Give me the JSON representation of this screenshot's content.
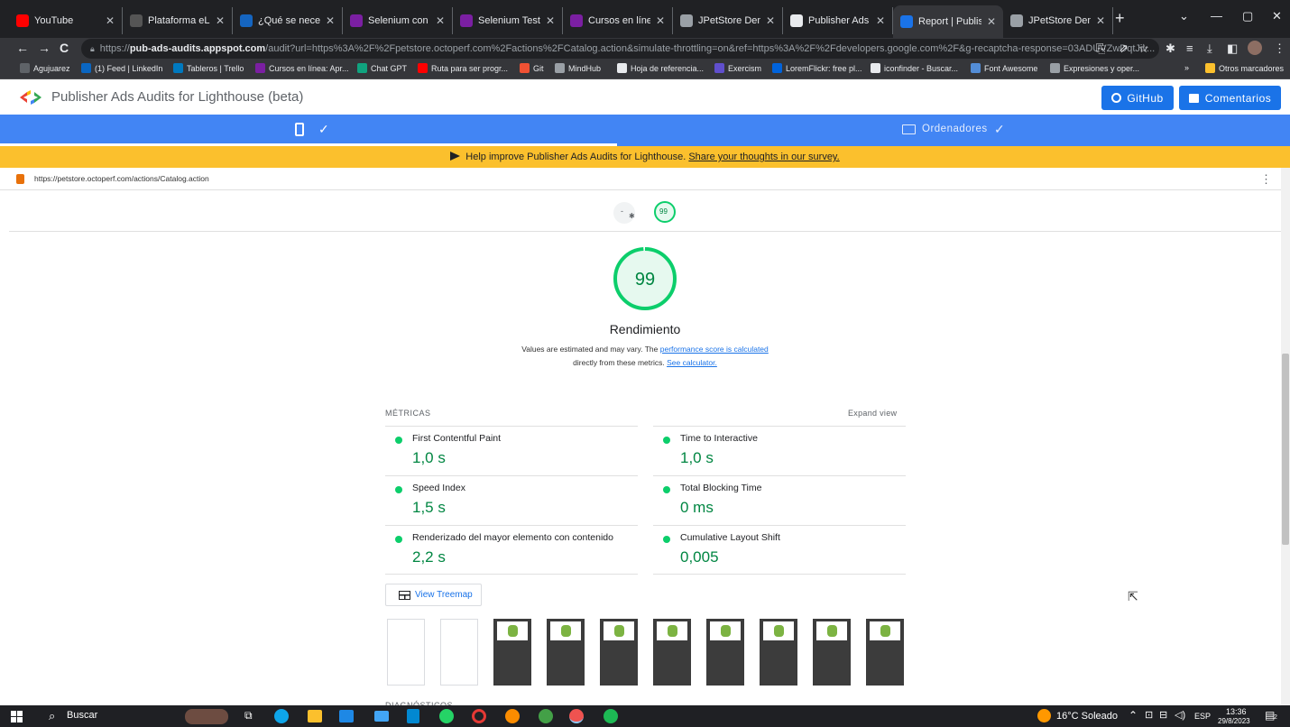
{
  "browser": {
    "tabs": [
      {
        "title": "YouTube",
        "color": "#ff0000"
      },
      {
        "title": "Plataforma eLearni",
        "color": "#555555"
      },
      {
        "title": "¿Qué se necesita p",
        "color": "#1565c0"
      },
      {
        "title": "Selenium con Java",
        "color": "#7b1fa2"
      },
      {
        "title": "Selenium Testing F",
        "color": "#7b1fa2"
      },
      {
        "title": "Cursos en línea: Ap",
        "color": "#7b1fa2"
      },
      {
        "title": "JPetStore Demo",
        "color": "#9aa0a6"
      },
      {
        "title": "Publisher Ads Audi",
        "color": "#e8eaed"
      },
      {
        "title": "Report | Publisher",
        "color": "#1a73e8"
      },
      {
        "title": "JPetStore Demo",
        "color": "#9aa0a6"
      }
    ],
    "new_tab": "+",
    "window_controls": {
      "min": "—",
      "max": "▢",
      "close": "✕",
      "tabsearch": "⌄"
    },
    "url_prefix": "https://",
    "url_host": "pub-ads-audits.appspot.com",
    "url_path": "/audit?url=https%3A%2F%2Fpetstore.octoperf.com%2Factions%2FCatalog.action&simulate-throttling=on&ref=https%3A%2F%2Fdevelopers.google.com%2F&g-recaptcha-response=03ADUVZwDqtJiv...",
    "bookmarks": [
      {
        "label": "Agujuarez",
        "color": "#5f6368"
      },
      {
        "label": "(1) Feed | LinkedIn",
        "color": "#0a66c2"
      },
      {
        "label": "Tableros | Trello",
        "color": "#0079bf"
      },
      {
        "label": "Cursos en línea: Apr...",
        "color": "#7b1fa2"
      },
      {
        "label": "Chat GPT",
        "color": "#10a37f"
      },
      {
        "label": "Ruta para ser progr...",
        "color": "#ff0000"
      },
      {
        "label": "Git",
        "color": "#f05133"
      },
      {
        "label": "MindHub",
        "color": "#9aa0a6"
      },
      {
        "label": "Hoja de referencia...",
        "color": "#e8eaed"
      },
      {
        "label": "Exercism",
        "color": "#604fcd"
      },
      {
        "label": "LoremFlickr: free pl...",
        "color": "#0063dc"
      },
      {
        "label": "iconfinder - Buscar...",
        "color": "#e8eaed"
      },
      {
        "label": "Font Awesome",
        "color": "#538dd7"
      },
      {
        "label": "Expresiones y oper...",
        "color": "#9aa0a6"
      }
    ],
    "bookmarks_more": "»",
    "other_bookmarks": "Otros marcadores"
  },
  "app": {
    "title": "Publisher Ads Audits for Lighthouse (beta)",
    "github_label": "GitHub",
    "feedback_label": "Comentarios",
    "desktop_tab": "Ordenadores",
    "check": "✓",
    "banner_text": "Help improve Publisher Ads Audits for Lighthouse.",
    "banner_link": "Share your thoughts in our survey."
  },
  "report": {
    "url": "https://petstore.octoperf.com/actions/Catalog.action",
    "mini_gauge_dash": "-",
    "mini_gauge_score": "99",
    "score": "99",
    "category": "Rendimiento",
    "desc_line1_prefix": "Values are estimated and may vary. The",
    "desc_link1": "performance score is calculated",
    "desc_line2_prefix": "directly from these metrics.",
    "desc_link2": "See calculator.",
    "metrics_title": "MÉTRICAS",
    "expand_view": "Expand view",
    "metrics": [
      {
        "name": "First Contentful Paint",
        "value": "1,0 s"
      },
      {
        "name": "Time to Interactive",
        "value": "1,0 s"
      },
      {
        "name": "Speed Index",
        "value": "1,5 s"
      },
      {
        "name": "Total Blocking Time",
        "value": "0 ms"
      },
      {
        "name": "Renderizado del mayor elemento con contenido",
        "value": "2,2 s"
      },
      {
        "name": "Cumulative Layout Shift",
        "value": "0,005"
      }
    ],
    "treemap_label": "View Treemap",
    "next_section": "DIAGNÓSTICOS",
    "pass_color": "#0cce6b"
  },
  "taskbar": {
    "search_label": "Buscar",
    "weather": "16°C  Soleado",
    "lang": "ESP",
    "time": "13:36",
    "date": "29/8/2023",
    "notif_count": "2"
  }
}
